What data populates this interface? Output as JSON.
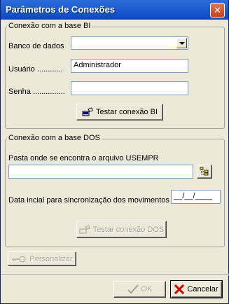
{
  "window": {
    "title": "Parâmetros de Conexões",
    "close_glyph": "✕"
  },
  "group_bi": {
    "legend": "Conexão com a base BI",
    "banco_label": "Banco de dados",
    "banco_value": "",
    "usuario_label": "Usuário ............",
    "usuario_value": "Administrador",
    "senha_label": "Senha ...............",
    "senha_value": "",
    "test_button": "Testar conexão BI",
    "test_icon": "connection-icon"
  },
  "group_dos": {
    "legend": "Conexão com a base DOS",
    "pasta_label": "Pasta onde se encontra o arquivo USEMPR",
    "pasta_value": "",
    "browse_icon": "folder-tree-icon",
    "data_label": "Data incial para sincronização dos movimentos",
    "data_value": "__/__/____",
    "test_button": "Testar conexão DOS",
    "test_icon": "connection-icon"
  },
  "personalizar_button": "Personalizar",
  "personalizar_icon": "key-icon",
  "ok_button": "OK",
  "ok_icon": "checkmark-icon",
  "cancel_button": "Cancelar",
  "cancel_icon": "red-x-icon",
  "colors": {
    "titlebar": "#0a49c4",
    "dialog": "#ece9d8",
    "cancel_icon": "#cc0000"
  }
}
